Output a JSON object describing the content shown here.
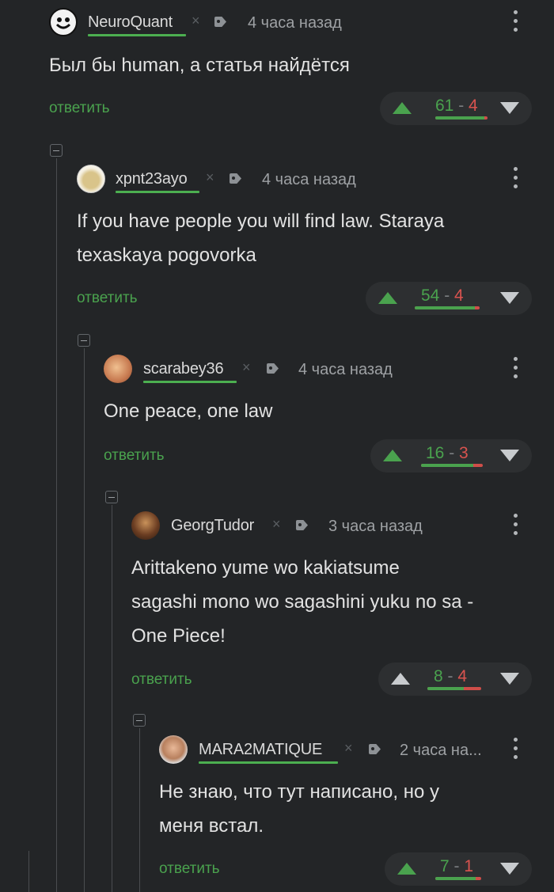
{
  "comments": [
    {
      "username": "NeuroQuant",
      "time": "4 часа назад",
      "text": "Был бы human, а статья найдётся",
      "reply_label": "ответить",
      "rating": {
        "plus": "61",
        "minus": "4",
        "separator": "-",
        "positive_share": 0.94
      }
    },
    {
      "username": "xpnt23ayo",
      "time": "4 часа назад",
      "text_lines": [
        "If you have people you will find law. Staraya",
        "texaskaya pogovorka"
      ],
      "reply_label": "ответить",
      "rating": {
        "plus": "54",
        "minus": "4",
        "separator": "-",
        "positive_share": 0.93
      }
    },
    {
      "username": "scarabey36",
      "time": "4 часа назад",
      "text": "One peace, one law",
      "reply_label": "ответить",
      "rating": {
        "plus": "16",
        "minus": "3",
        "separator": "-",
        "positive_share": 0.84
      }
    },
    {
      "username": "GeorgTudor",
      "time": "3 часа назад",
      "text_lines": [
        "Arittakeno yume wo kakiatsume",
        "sagashi mono wo sagashini yuku no sa -",
        "One Piece!"
      ],
      "reply_label": "ответить",
      "rating": {
        "plus": "8",
        "minus": "4",
        "separator": "-",
        "positive_share": 0.67
      }
    },
    {
      "username": "MARA2MATIQUE",
      "time": "2 часа на...",
      "text_lines": [
        "Не знаю, что тут написано, но у",
        "меня встал."
      ],
      "reply_label": "ответить",
      "rating": {
        "plus": "7",
        "minus": "1",
        "separator": "-",
        "positive_share": 0.88
      }
    }
  ],
  "icons": {
    "collapse": "minus-square-icon",
    "tag": "tag-icon",
    "more": "more-vertical-icon",
    "upvote": "arrow-up-icon",
    "downvote": "arrow-down-icon",
    "ignore": "close-icon"
  },
  "colors": {
    "background": "#232527",
    "positive": "#4aa24e",
    "negative": "#d9534f",
    "username_underline": "#4caf50"
  }
}
